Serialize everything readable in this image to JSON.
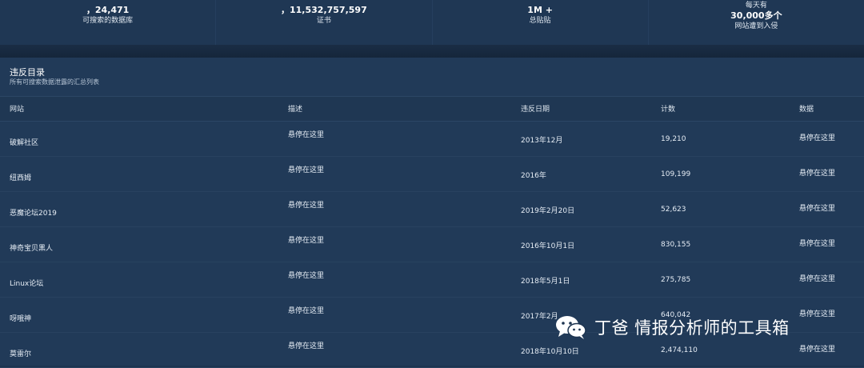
{
  "stats": [
    {
      "value": "，24,471",
      "label": "可搜索的数据库"
    },
    {
      "value": "，11,532,757,597",
      "label": "证书"
    },
    {
      "value": "1M +",
      "label": "总贴贴"
    },
    {
      "pre": "每天有",
      "value": "30,000多个",
      "label": "网站遭到入侵"
    }
  ],
  "section": {
    "title": "违反目录",
    "subtitle": "所有可搜索数据泄露的汇总列表"
  },
  "table": {
    "headers": [
      "网站",
      "描述",
      "违反日期",
      "计数",
      "数据"
    ],
    "rows": [
      {
        "site": "破解社区",
        "desc": "悬停在这里",
        "date": "2013年12月",
        "count": "19,210",
        "data": "悬停在这里"
      },
      {
        "site": "纽西姆",
        "desc": "悬停在这里",
        "date": "2016年",
        "count": "109,199",
        "data": "悬停在这里"
      },
      {
        "site": "恶魔论坛2019",
        "desc": "悬停在这里",
        "date": "2019年2月20日",
        "count": "52,623",
        "data": "悬停在这里"
      },
      {
        "site": "神奇宝贝黑人",
        "desc": "悬停在这里",
        "date": "2016年10月1日",
        "count": "830,155",
        "data": "悬停在这里"
      },
      {
        "site": "Linux论坛",
        "desc": "悬停在这里",
        "date": "2018年5月1日",
        "count": "275,785",
        "data": "悬停在这里"
      },
      {
        "site": "呀哦神",
        "desc": "悬停在这里",
        "date": "2017年2月",
        "count": "640,042",
        "data": "悬停在这里"
      },
      {
        "site": "莫雷尔",
        "desc": "悬停在这里",
        "date": "2018年10月10日",
        "count": "2,474,110",
        "data": "悬停在这里"
      }
    ]
  },
  "watermark": {
    "text": "丁爸 情报分析师的工具箱",
    "icon": "wechat-icon"
  }
}
